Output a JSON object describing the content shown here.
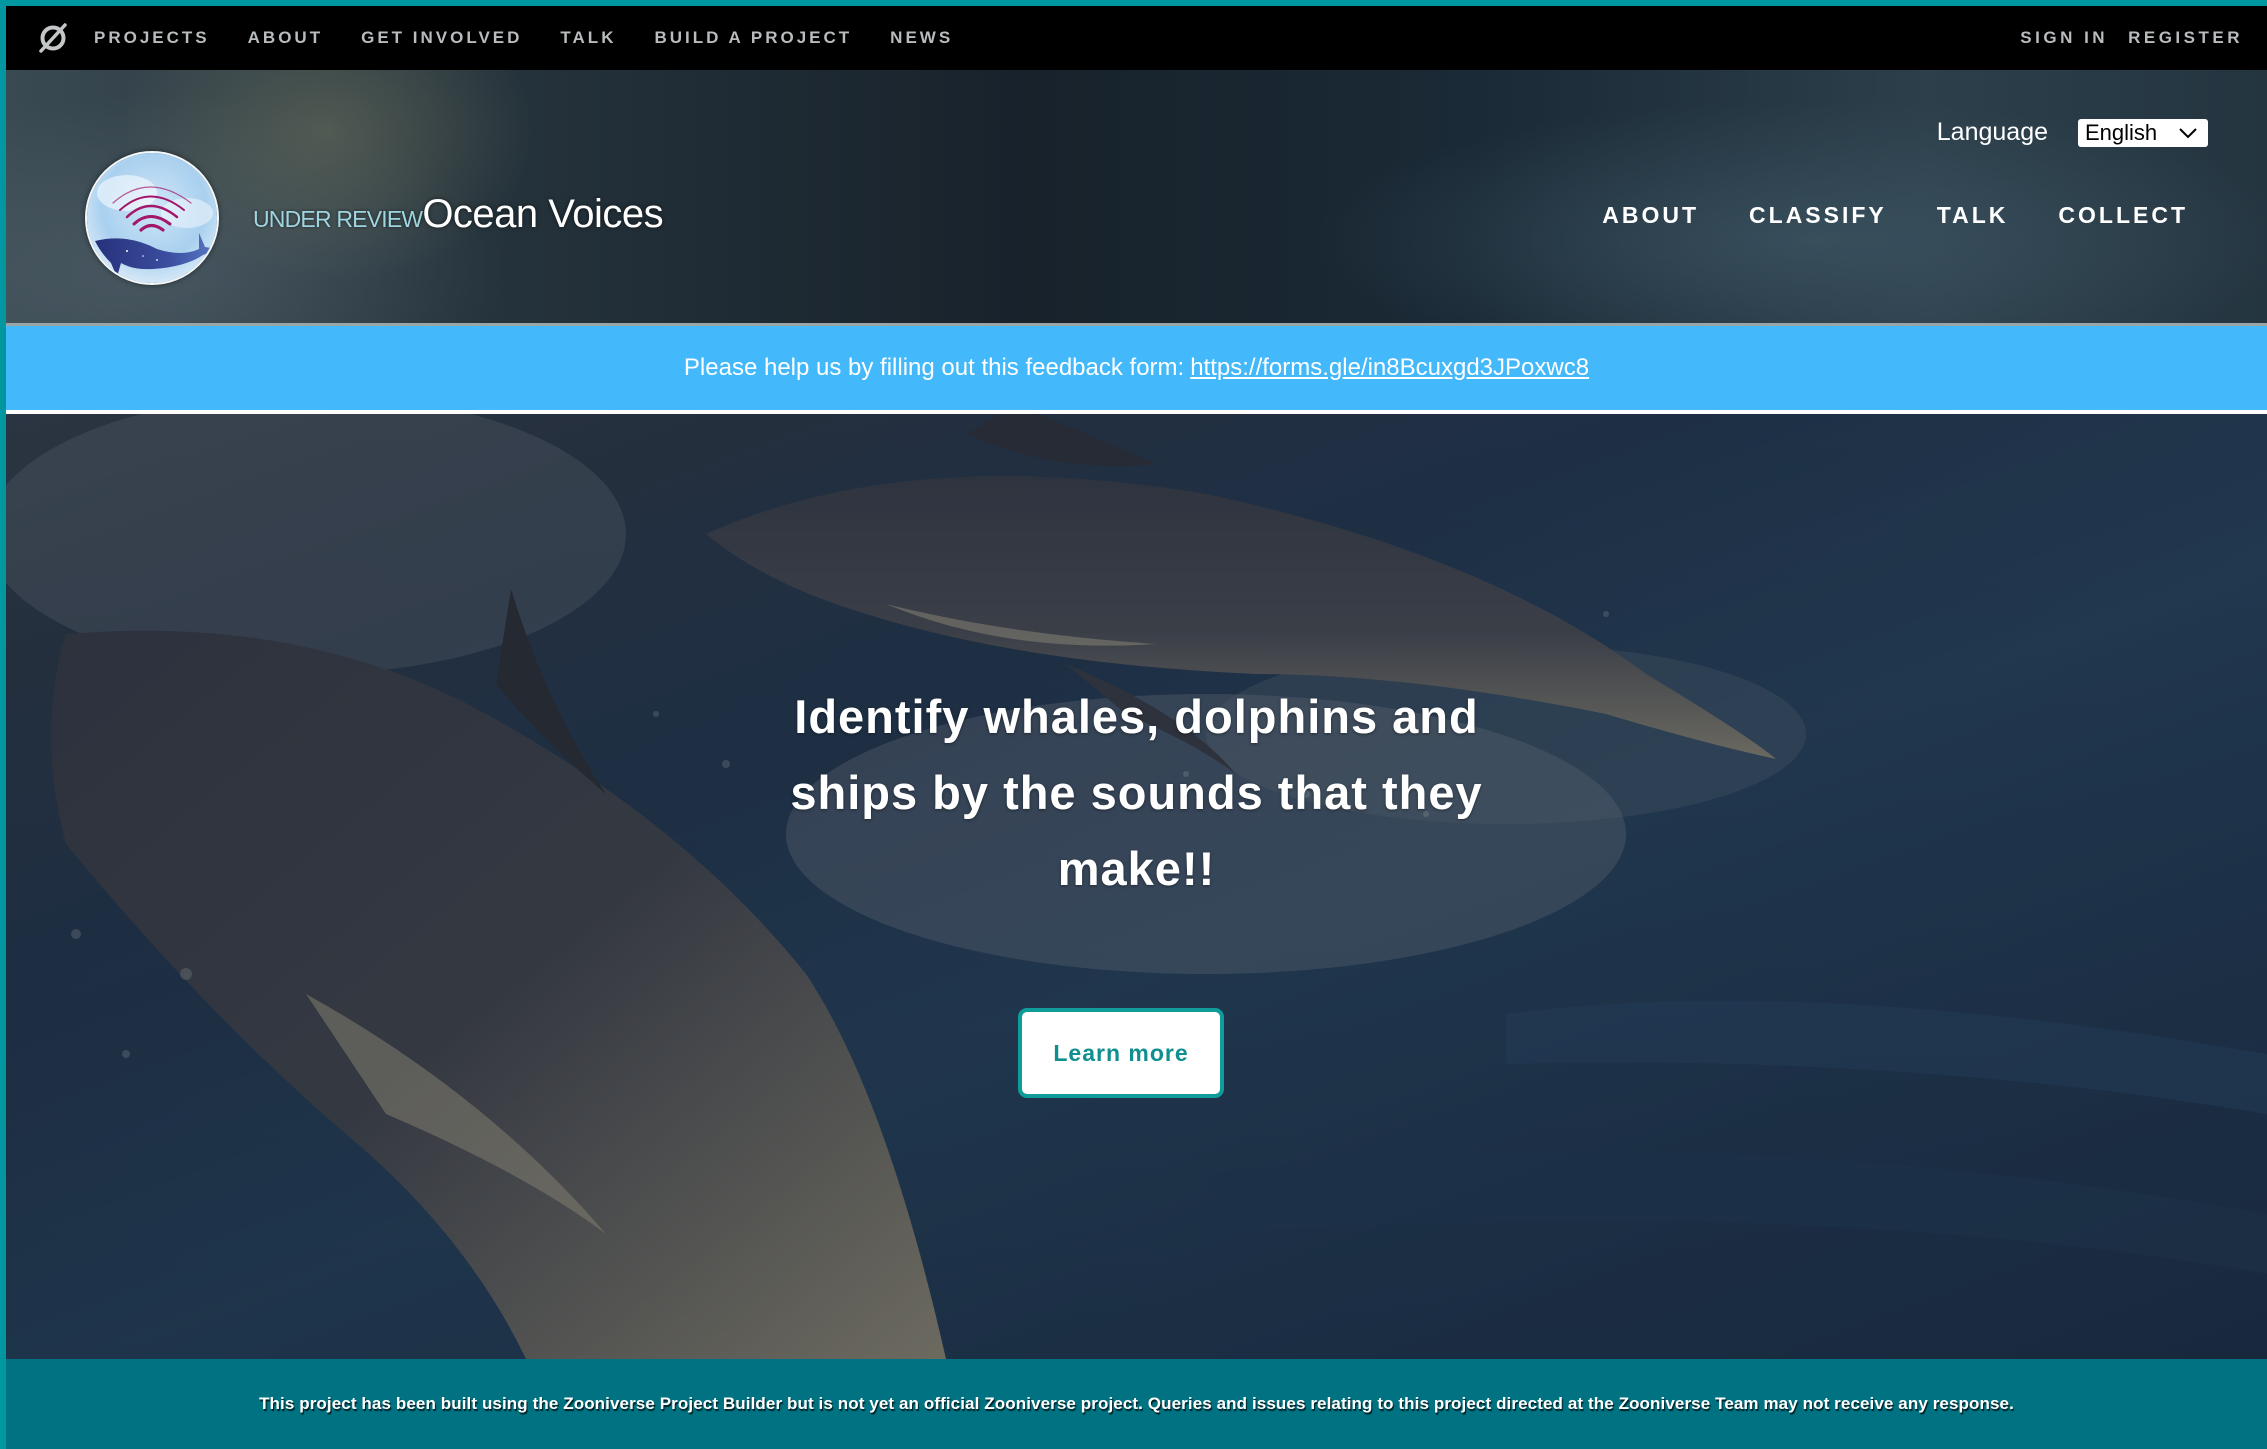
{
  "zooniverse_bar": {
    "logo_icon": "zooniverse-logo-icon",
    "nav": [
      {
        "label": "PROJECTS"
      },
      {
        "label": "ABOUT"
      },
      {
        "label": "GET INVOLVED"
      },
      {
        "label": "TALK"
      },
      {
        "label": "BUILD A PROJECT"
      },
      {
        "label": "NEWS"
      }
    ],
    "auth": {
      "sign_in": "SIGN IN",
      "register": "REGISTER"
    }
  },
  "project_header": {
    "status_label": "UNDER REVIEW",
    "title": "Ocean Voices",
    "language_label": "Language",
    "language_selected": "English",
    "nav": [
      {
        "label": "ABOUT"
      },
      {
        "label": "CLASSIFY"
      },
      {
        "label": "TALK"
      },
      {
        "label": "COLLECT"
      }
    ]
  },
  "banner": {
    "text": "Please help us by filling out this feedback form:",
    "link_text": "https://forms.gle/in8Bcuxgd3JPoxwc8"
  },
  "hero": {
    "lines": [
      "Identify whales, dolphins and",
      "ships by the sounds that they",
      "make!!"
    ],
    "button_label": "Learn more"
  },
  "footer_notice": {
    "text": "This project has been built using the Zooniverse Project Builder but is not yet an official Zooniverse project. Queries and issues relating to this project directed at the Zooniverse Team may not receive any response."
  },
  "colors": {
    "frame_accent": "#0097a0",
    "banner_bg": "#43b9fb",
    "button_accent": "#0f9c9a",
    "footer_bg": "#007281"
  }
}
